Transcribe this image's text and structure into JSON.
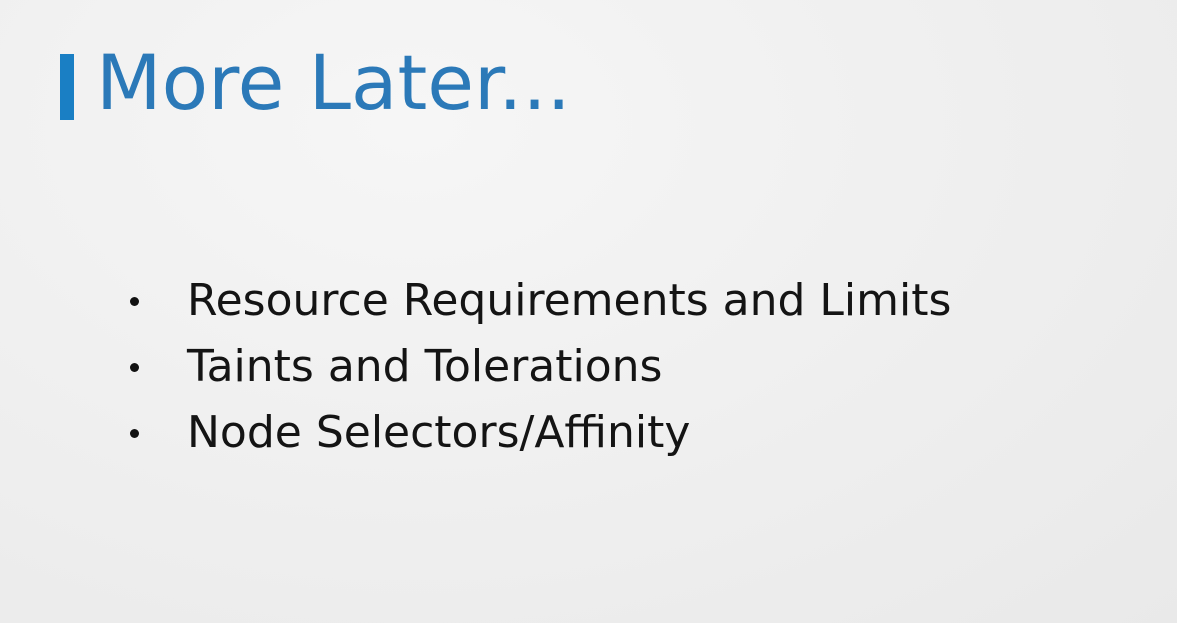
{
  "slide": {
    "title": "More Later...",
    "accent_color": "#1a7fc4",
    "title_color": "#2b79b8",
    "bullets": [
      "Resource Requirements and Limits",
      "Taints and Tolerations",
      "Node Selectors/Affinity"
    ]
  }
}
